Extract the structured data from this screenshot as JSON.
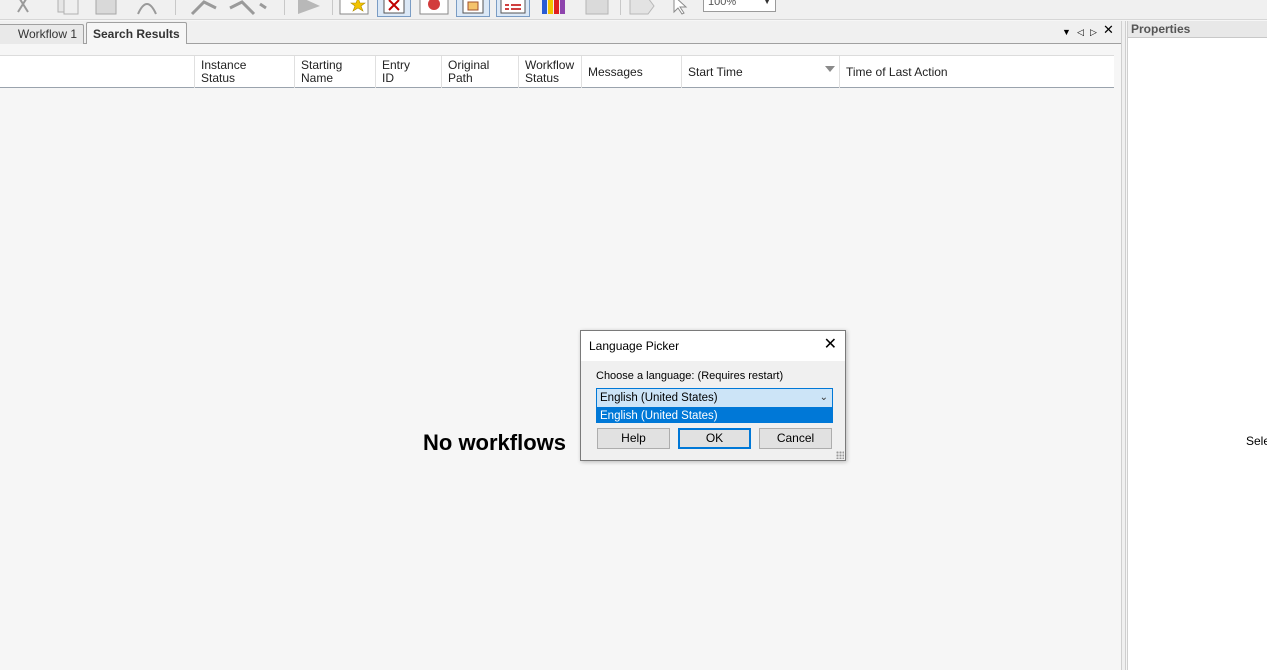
{
  "toolbar": {
    "zoom": "100%",
    "icons": [
      "scissors-icon",
      "copy-icon",
      "paste-icon",
      "cut-tool-icon",
      "undo-icon",
      "redo-icon",
      "run-icon",
      "new-starred-icon",
      "delete-icon",
      "debug-icon",
      "copy-activity-icon",
      "checklist-icon",
      "crayons-icon",
      "grid-icon",
      "tag-icon",
      "pointer-icon"
    ]
  },
  "tabs": [
    {
      "label": "Workflow 1"
    },
    {
      "label": "Search Results"
    }
  ],
  "columns": [
    {
      "label": "Instance\nStatus"
    },
    {
      "label": "Starting\nName"
    },
    {
      "label": "Entry\nID"
    },
    {
      "label": "Original\nPath"
    },
    {
      "label": "Workflow\nStatus"
    },
    {
      "label": "Messages"
    },
    {
      "label": "Start Time"
    },
    {
      "label": "Time of Last Action"
    }
  ],
  "main": {
    "empty_message": "No workflows"
  },
  "properties": {
    "title": "Properties",
    "placeholder": "Sele"
  },
  "dialog": {
    "title": "Language Picker",
    "prompt": "Choose a language: (Requires restart)",
    "selected_language": "English (United States)",
    "options": [
      "English (United States)"
    ],
    "help_label": "Help",
    "ok_label": "OK",
    "cancel_label": "Cancel"
  },
  "colors": {
    "accent": "#0078d7",
    "selection_bg": "#cce4f7"
  }
}
